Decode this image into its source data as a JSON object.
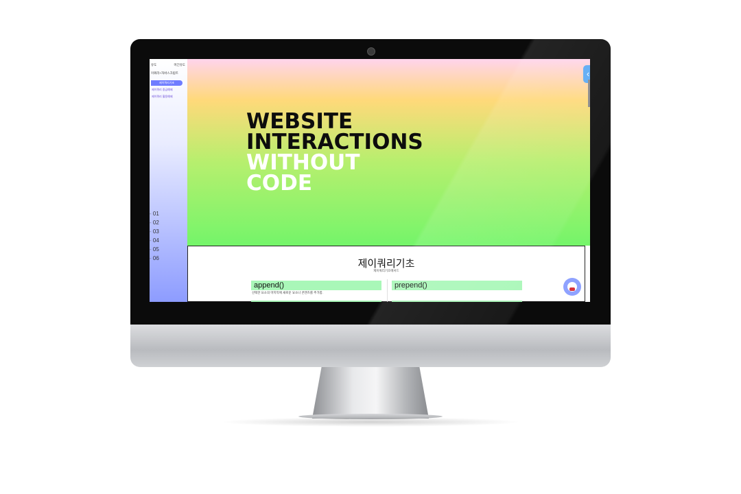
{
  "sidebar": {
    "top_left": "유도",
    "top_right": "머긴유도",
    "subtitle": "이쿼리+자바스크립트",
    "active_item": "제이쿼리기초",
    "links": [
      "제이쿼리 중급예제",
      "제이쿼리 활용예제"
    ],
    "numbers": [
      "01",
      "02",
      "03",
      "04",
      "05",
      "06"
    ]
  },
  "hero": {
    "line1": "WEBSITE",
    "line2": "INTERACTIONS",
    "line3": "WITHOUT",
    "line4": "CODE",
    "toggle_icon": "‹"
  },
  "content": {
    "title": "제이쿼리기초",
    "subtitle": "제이쿼리기초메서드",
    "cards": [
      {
        "label": "append()",
        "desc": "선택한 요소의 마지막에 새로운 요소나 콘텐츠를 추가함."
      },
      {
        "label": "prepend()",
        "desc": ""
      }
    ]
  },
  "colors": {
    "sidebar_active": "#6f7cff",
    "card_bg": "#a9f7b8",
    "toggle_bg": "#5aa9f4"
  }
}
